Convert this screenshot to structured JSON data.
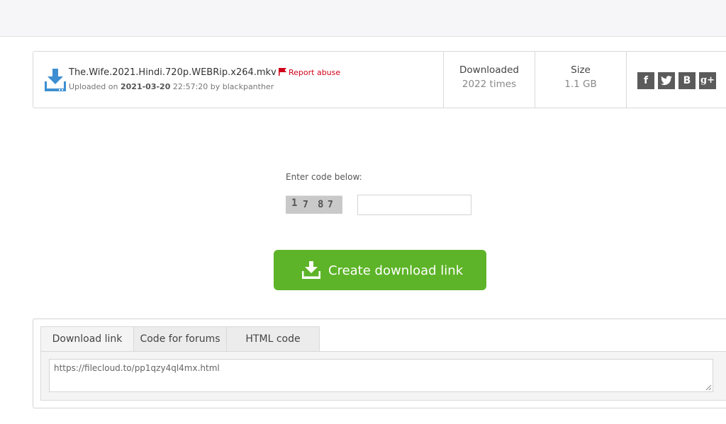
{
  "file": {
    "name": "The.Wife.2021.Hindi.720p.WEBRip.x264.mkv",
    "report_label": "Report abuse",
    "uploaded_prefix": "Uploaded on ",
    "upload_date": "2021-03-20",
    "upload_rest": " 22:57:20 by blackpanther"
  },
  "stats": {
    "downloaded_label": "Downloaded",
    "downloaded_value": "2022 times",
    "size_label": "Size",
    "size_value": "1.1 GB"
  },
  "social": {
    "facebook": "f",
    "twitter": "twitter-bird",
    "vk": "B",
    "google_plus": "g+"
  },
  "captcha": {
    "label": "Enter code below:",
    "digits": [
      "1",
      "7",
      "8",
      "7"
    ],
    "input_value": ""
  },
  "create_button": {
    "label": "Create download link"
  },
  "link_panel": {
    "tabs": [
      "Download link",
      "Code for forums",
      "HTML code"
    ],
    "active_tab": "Download link",
    "link_value": "https://filecloud.to/pp1qzy4ql4mx.html"
  },
  "colors": {
    "accent_green": "#5db428",
    "icon_blue": "#3d8fd1",
    "report_red": "#d0021b",
    "social_gray": "#5b5b5b"
  }
}
